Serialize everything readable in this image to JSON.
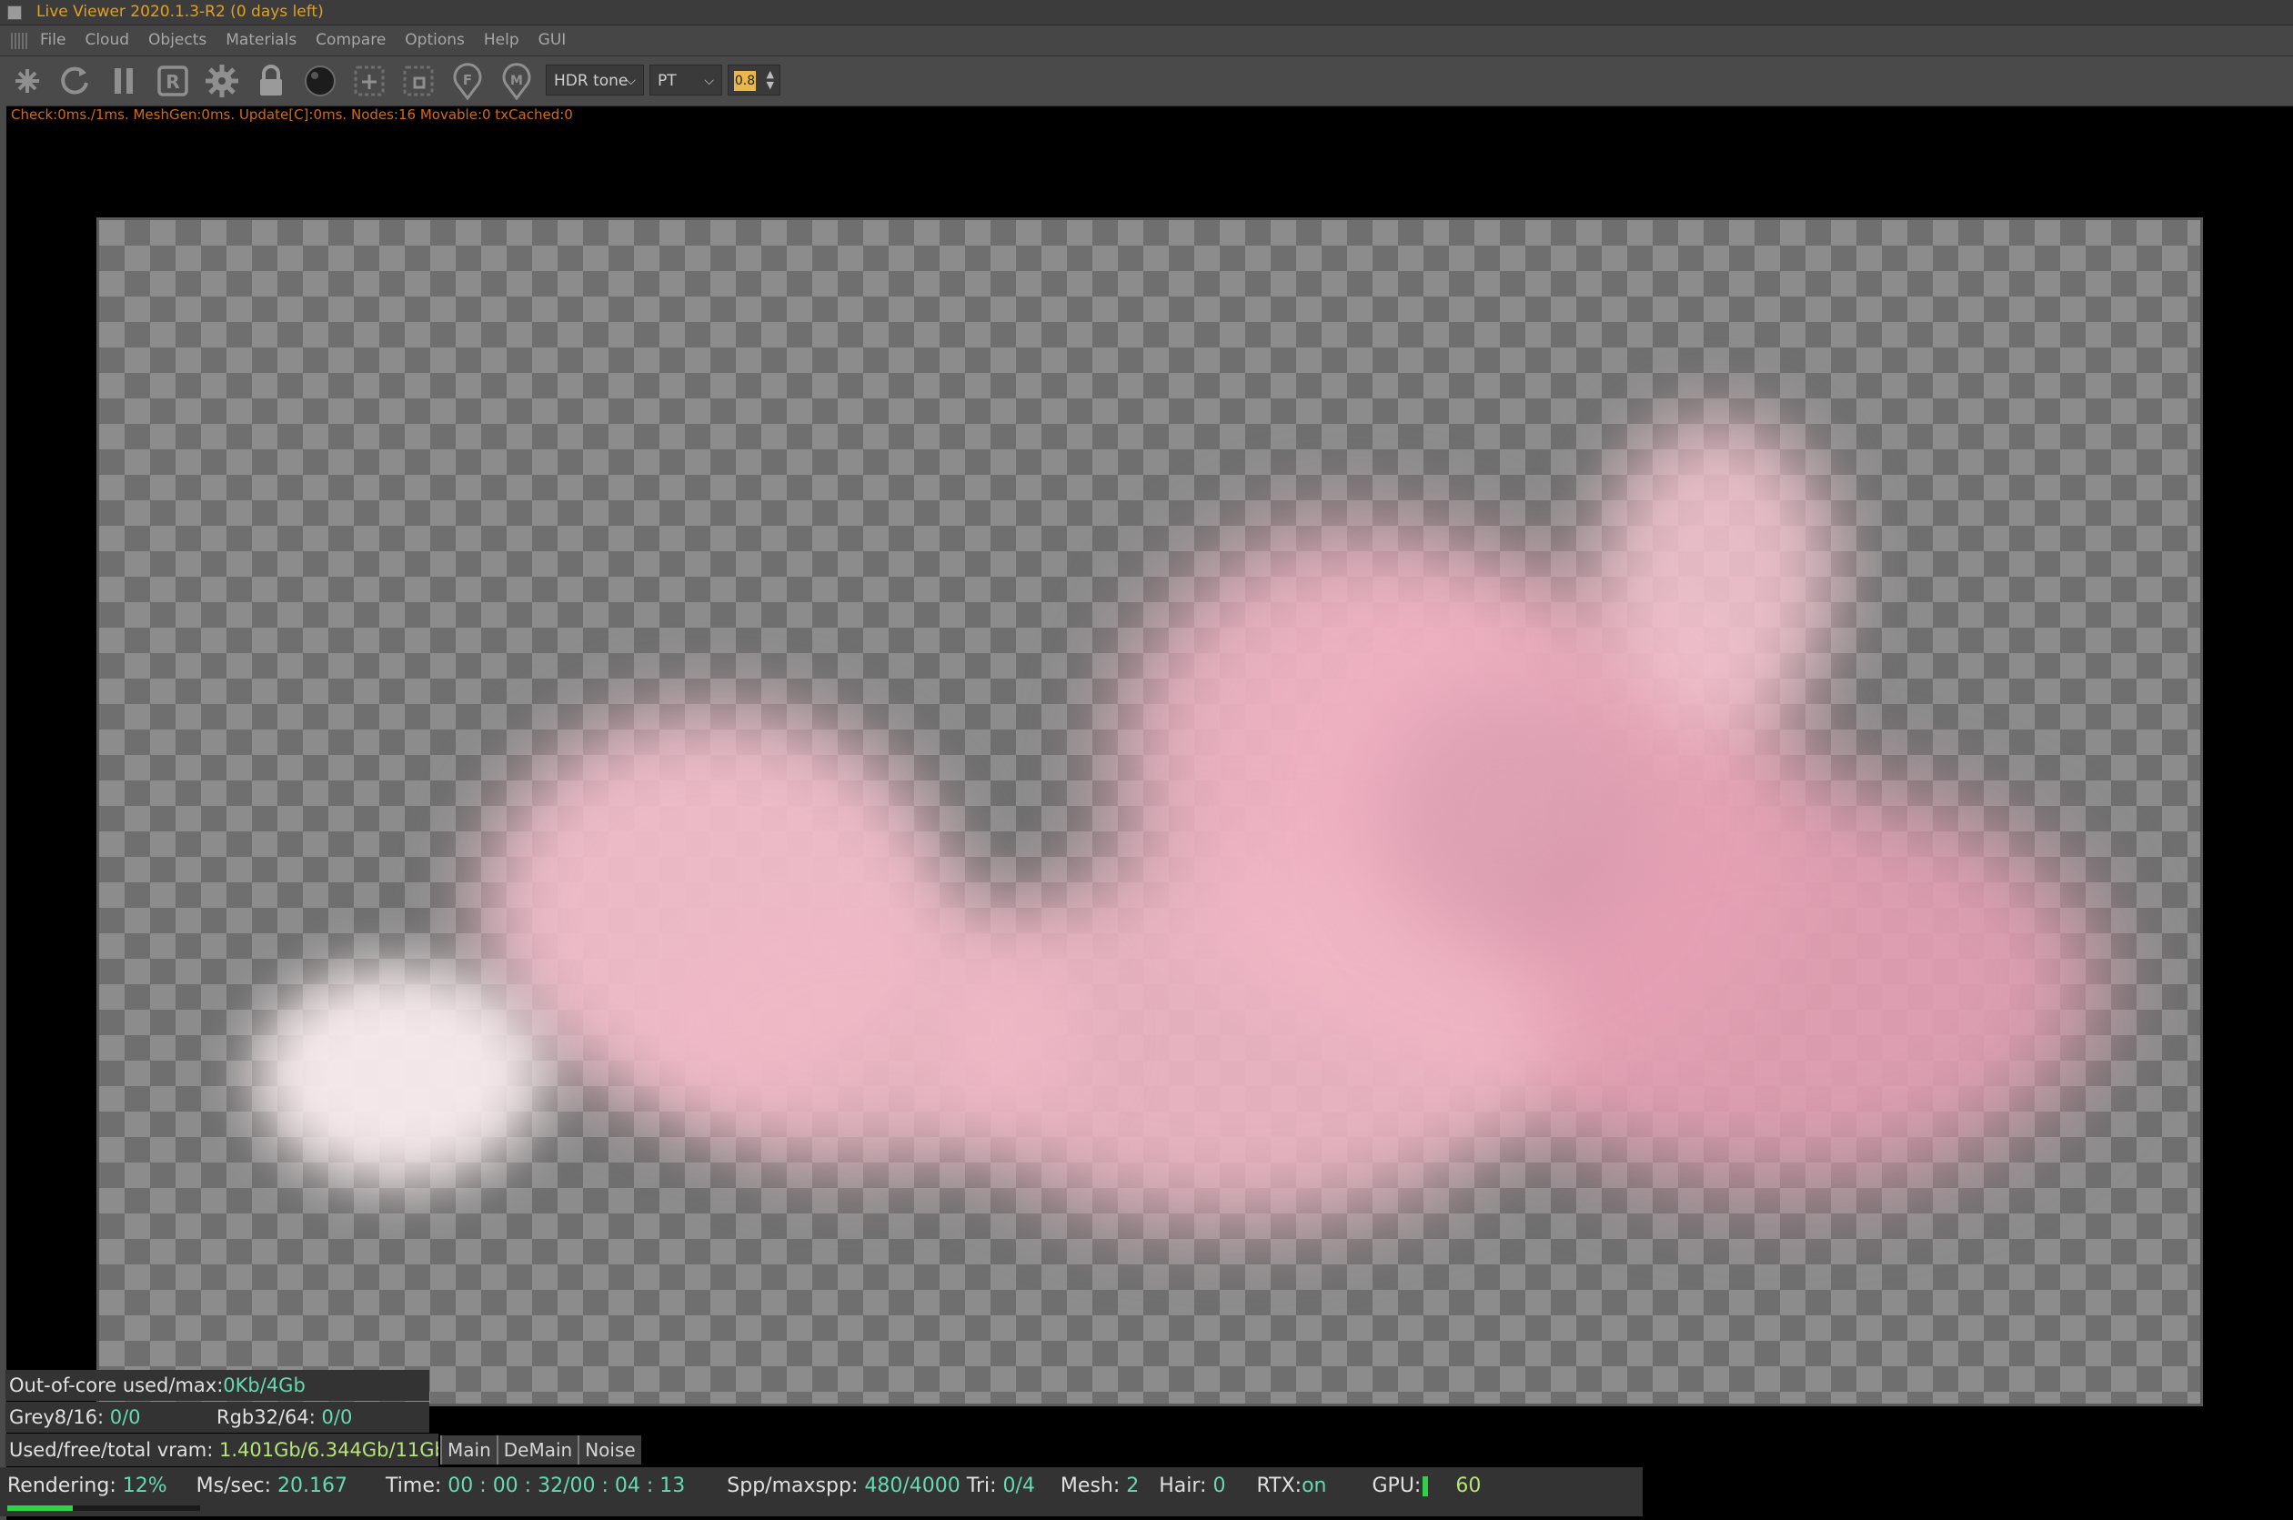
{
  "window": {
    "title": "Live Viewer 2020.1.3-R2 (0 days left)"
  },
  "menu": {
    "items": [
      "File",
      "Cloud",
      "Objects",
      "Materials",
      "Compare",
      "Options",
      "Help",
      "GUI"
    ]
  },
  "toolbar": {
    "icons": [
      "send-scene-icon",
      "restart-icon",
      "pause-icon",
      "region-render-icon",
      "settings-gear-icon",
      "lock-icon",
      "material-ball-icon",
      "add-region-icon",
      "focus-region-icon",
      "focus-pick-icon",
      "material-pick-icon"
    ],
    "r_label": "R",
    "f_label": "F",
    "m_label": "M",
    "tone_select": "HDR tone",
    "kernel_select": "PT",
    "value_box": "0.8"
  },
  "stats_line": "Check:0ms./1ms. MeshGen:0ms. Update[C]:0ms. Nodes:16 Movable:0 txCached:0",
  "info": {
    "ooc_label": "Out-of-core used/max:",
    "ooc_value": "0Kb/4Gb",
    "grey_label": "Grey8/16:",
    "grey_value": "0/0",
    "rgb_label": "Rgb32/64:",
    "rgb_value": "0/0",
    "vram_label": "Used/free/total vram:",
    "vram_value": "1.401Gb/6.344Gb/11Gb"
  },
  "tabs": [
    "Main",
    "DeMain",
    "Noise"
  ],
  "status": {
    "rendering_label": "Rendering:",
    "rendering_value": "12%",
    "rendering_progress": 0.12,
    "mssec_label": "Ms/sec:",
    "mssec_value": "20.167",
    "time_label": "Time:",
    "time_value": "00 : 00 : 32/00 : 04 : 13",
    "spp_label": "Spp/maxspp:",
    "spp_value": "480/4000",
    "tri_label": "Tri:",
    "tri_value": "0/4",
    "mesh_label": "Mesh:",
    "mesh_value": "2",
    "hair_label": "Hair:",
    "hair_value": "0",
    "rtx_label": "RTX:",
    "rtx_value": "on",
    "gpu_label": "GPU:",
    "gpu_value": "60"
  },
  "colors": {
    "title_text": "#e0a020",
    "stats_text": "#d46a10",
    "value_text": "#66d9b0",
    "progress_fill": "#2dd24a",
    "cloud_pink": "#f2b4c2"
  }
}
